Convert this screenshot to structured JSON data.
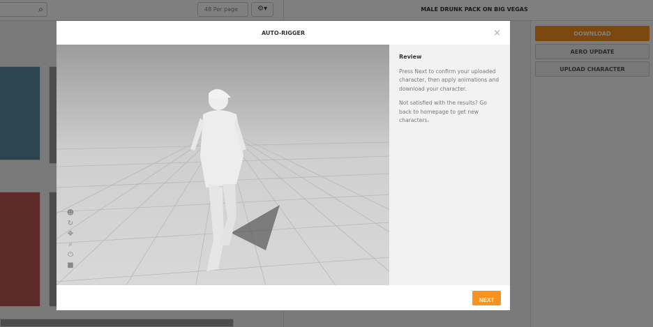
{
  "topbar": {
    "per_page": "48 Per page",
    "gear": "⚙▾",
    "search_icon": "⌕"
  },
  "right": {
    "title": "MALE DRUNK PACK ON BIG VEGAS",
    "download": "DOWNLOAD",
    "aero_update": "AERO UPDATE",
    "upload": "UPLOAD CHARACTER"
  },
  "modal": {
    "title": "AUTO-RIGGER",
    "close": "×",
    "review_heading": "Review",
    "p1": "Press Next to confirm your uploaded character, then apply animations and download your character.",
    "p2": "Not satisfied with the results? Go back to homepage to get new characters.",
    "next": "NEXT"
  },
  "tools": [
    "☻",
    "↻",
    "✥",
    "⌕",
    "⏻",
    "■"
  ],
  "colors": {
    "accent": "#f7931e"
  }
}
